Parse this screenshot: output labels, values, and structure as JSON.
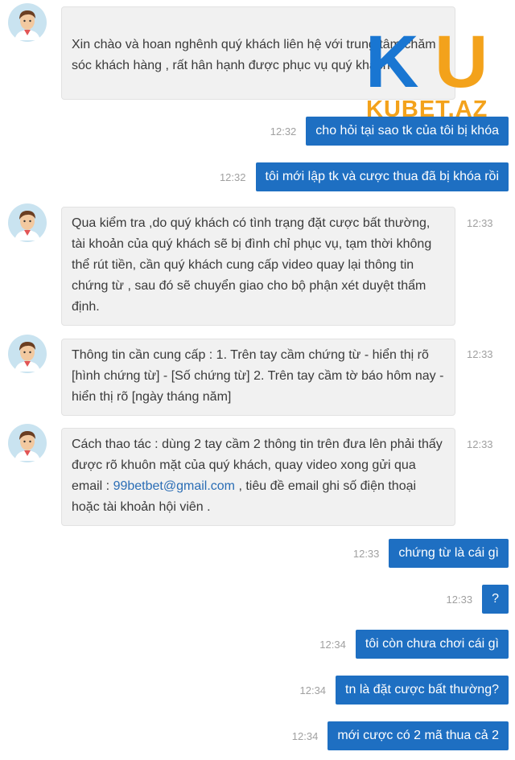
{
  "logo": {
    "letters": "KU",
    "text": "KUBET.AZ"
  },
  "agent_messages": [
    {
      "text": "Xin chào và hoan nghênh quý khách liên hệ với trung tâm chăm sóc khách hàng , rất hân hạnh được phục vụ quý khách .",
      "time": ""
    },
    {
      "text": "Qua kiểm tra ,do quý khách có tình trạng đặt cược bất thường, tài khoản của quý khách sẽ bị đình chỉ phục vụ, tạm thời không thể rút tiền, cần quý khách cung cấp video quay lại thông tin chứng từ , sau đó sẽ chuyển giao cho bộ phận xét duyệt thẩm định.",
      "time": "12:33"
    },
    {
      "text": "Thông tin cần cung cấp : 1. Trên tay cầm chứng từ - hiển thị rõ [hình chứng từ] - [Số chứng từ] 2. Trên tay cầm tờ báo hôm nay - hiển thị rõ [ngày tháng năm]",
      "time": "12:33"
    },
    {
      "text_before": "Cách thao tác : dùng 2 tay cầm 2 thông tin trên đưa lên phải thấy được rõ khuôn mặt của quý khách, quay video xong gửi qua email : ",
      "email": "99betbet@gmail.com",
      "text_after": " , tiêu đề email ghi số điện thoại hoặc tài khoản hội viên .",
      "time": "12:33"
    }
  ],
  "user_messages": [
    {
      "text": "cho hỏi tại sao tk của tôi bị khóa",
      "time": "12:32"
    },
    {
      "text": "tôi mới lập tk và cược thua đã bị khóa rồi",
      "time": "12:32"
    },
    {
      "text": "chứng từ là cái gì",
      "time": "12:33"
    },
    {
      "text": "?",
      "time": "12:33"
    },
    {
      "text": "tôi còn chưa chơi cái gì",
      "time": "12:34"
    },
    {
      "text": "tn là đặt cược bất thường?",
      "time": "12:34"
    },
    {
      "text": "mới cược có 2 mã thua cả 2",
      "time": "12:34"
    }
  ],
  "colors": {
    "user_bubble": "#1e6fc2",
    "agent_bubble": "#f1f1f1",
    "logo_blue": "#1976d2",
    "logo_orange": "#f3a21b",
    "email_link": "#2a6db5"
  }
}
